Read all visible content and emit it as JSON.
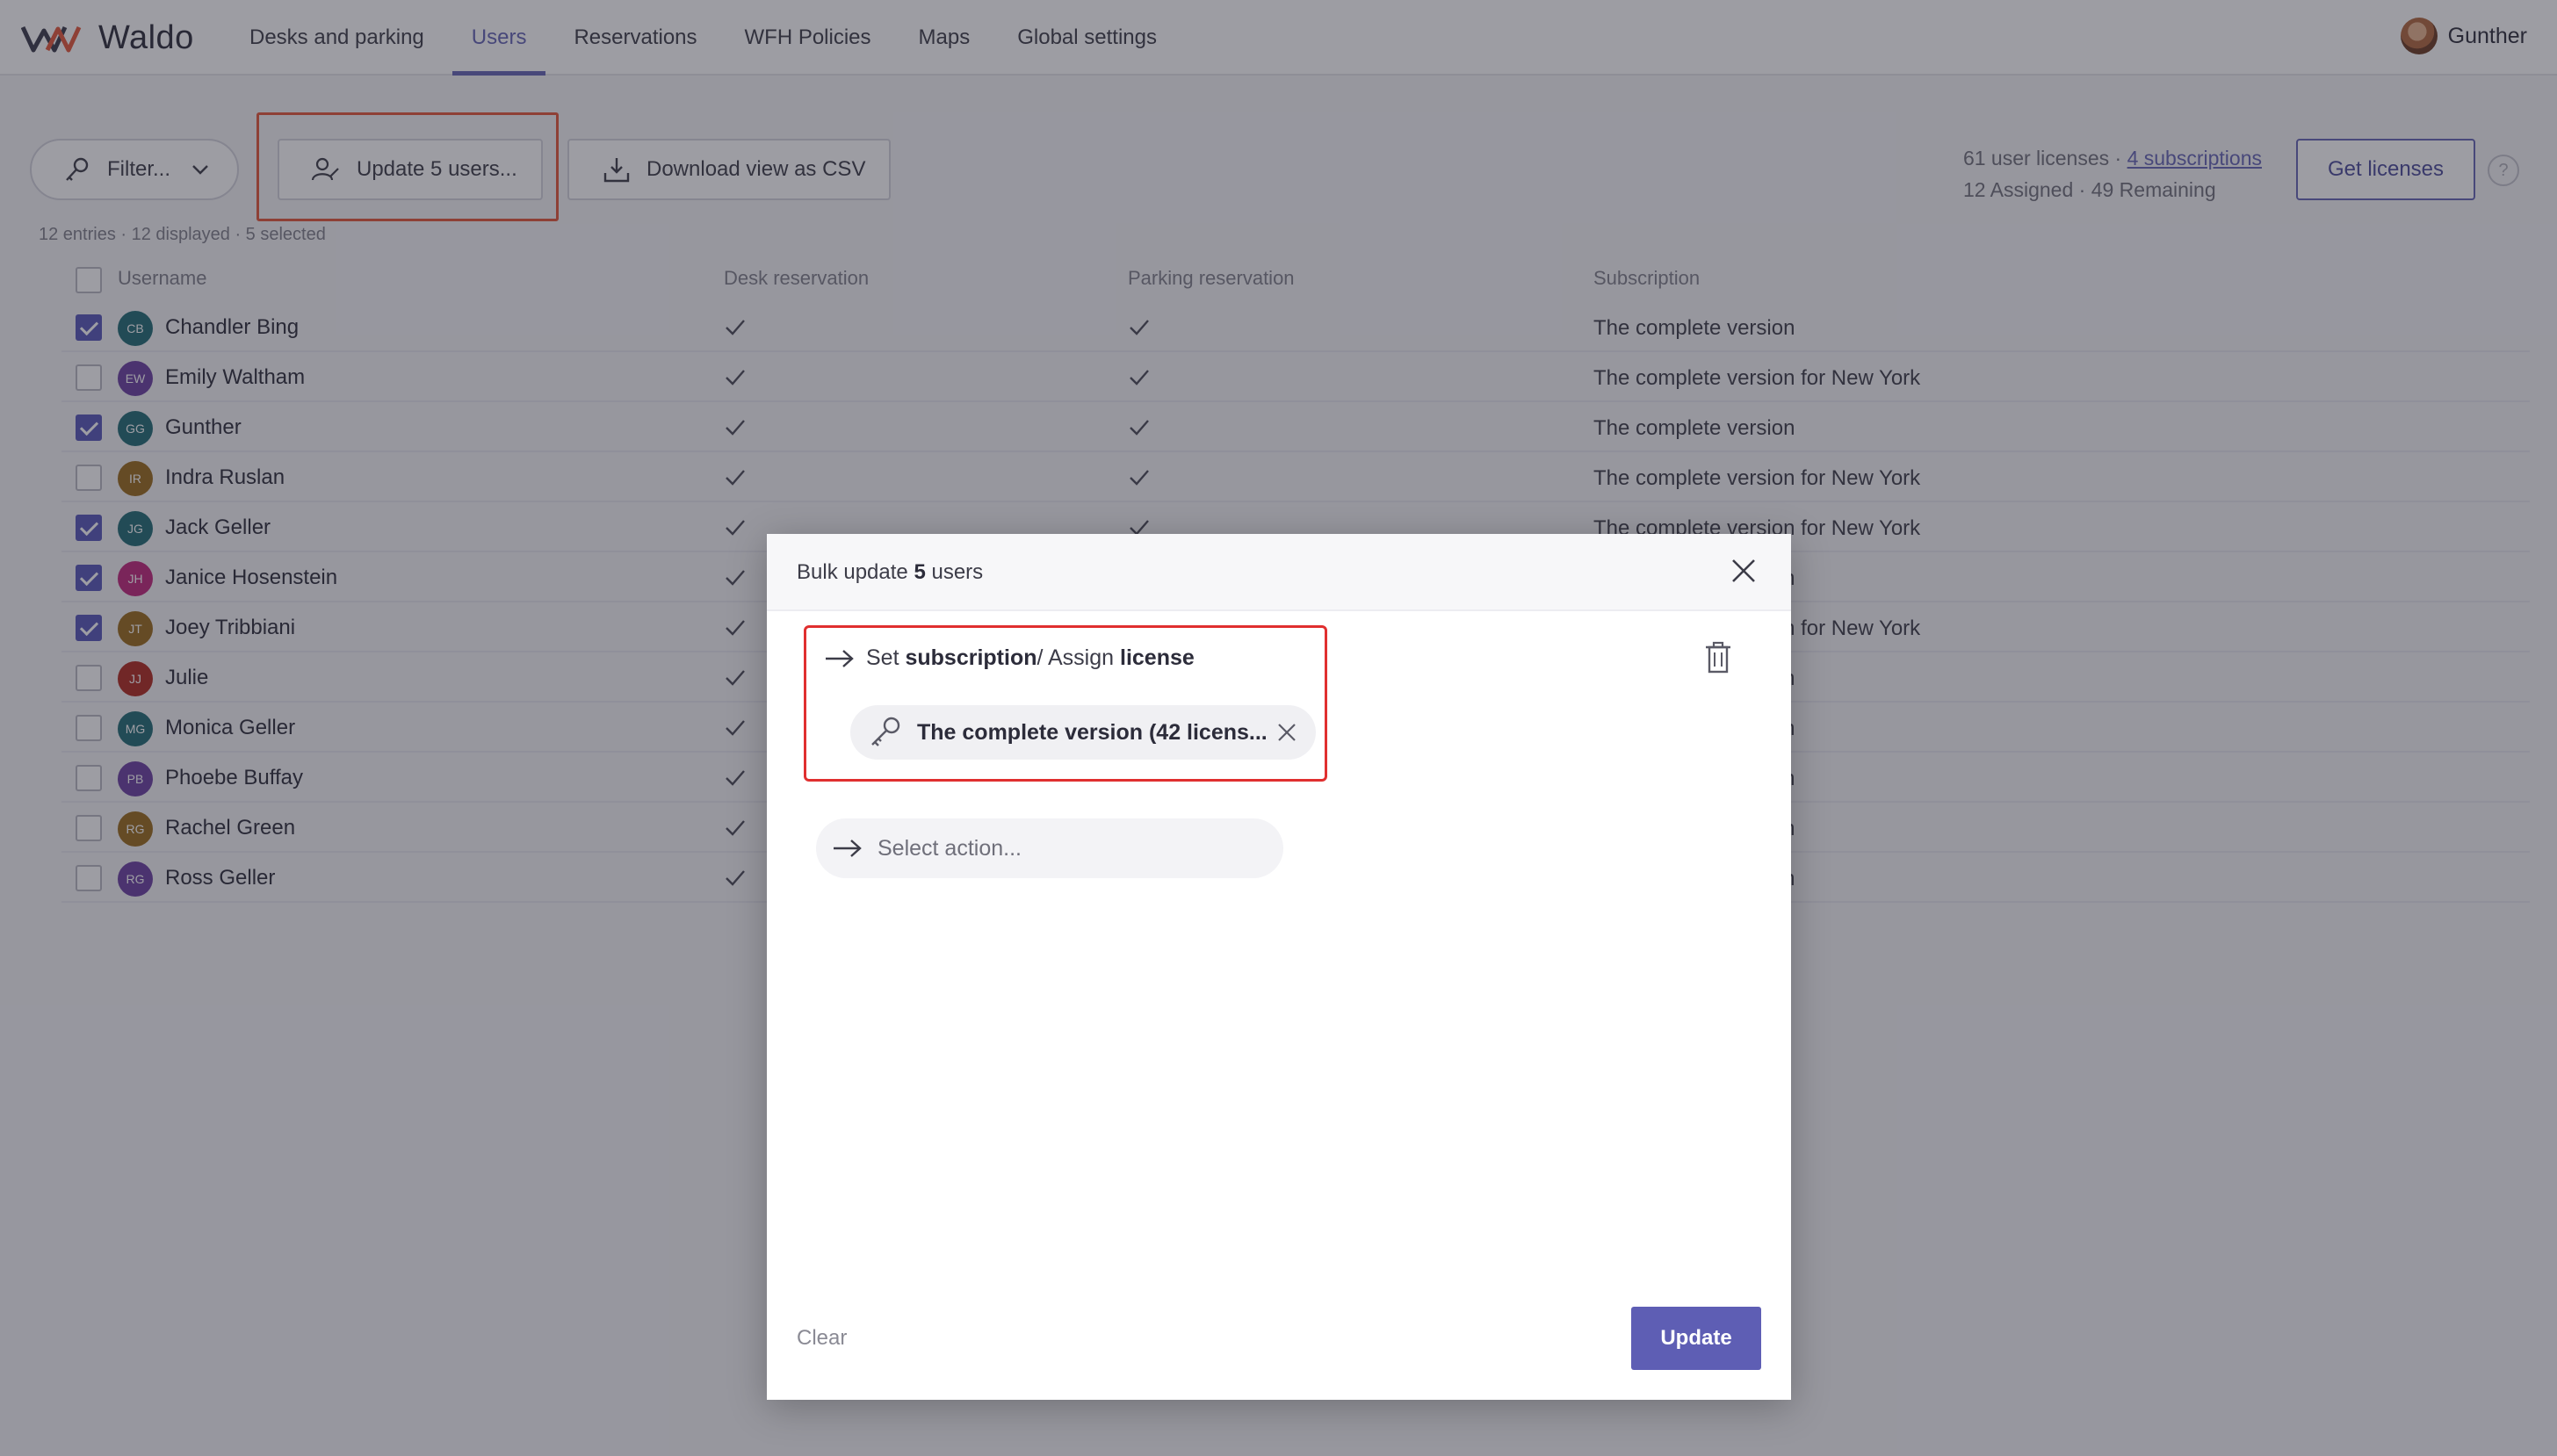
{
  "app": {
    "name": "Waldo"
  },
  "nav": {
    "items": [
      {
        "label": "Desks and parking",
        "active": false
      },
      {
        "label": "Users",
        "active": true
      },
      {
        "label": "Reservations",
        "active": false
      },
      {
        "label": "WFH Policies",
        "active": false
      },
      {
        "label": "Maps",
        "active": false
      },
      {
        "label": "Global settings",
        "active": false
      }
    ],
    "user_name": "Gunther"
  },
  "toolbar": {
    "filter_label": "Filter...",
    "update_label": "Update 5 users...",
    "csv_label": "Download view as CSV",
    "licenses_line1_prefix": "61 user licenses · ",
    "licenses_link": "4 subscriptions",
    "licenses_line2": "12 Assigned · 49 Remaining",
    "get_licenses_label": "Get licenses",
    "help_label": "?"
  },
  "entries_text": "12 entries · 12 displayed · 5 selected",
  "table": {
    "columns": {
      "username": "Username",
      "desk": "Desk reservation",
      "parking": "Parking reservation",
      "subscription": "Subscription"
    },
    "rows": [
      {
        "initials": "CB",
        "name": "Chandler Bing",
        "selected": true,
        "color": "#1f6b73",
        "subscription": "The complete version"
      },
      {
        "initials": "EW",
        "name": "Emily Waltham",
        "selected": false,
        "color": "#6a3fa0",
        "subscription": "The complete version for New York"
      },
      {
        "initials": "GG",
        "name": "Gunther",
        "selected": true,
        "color": "#1f6b73",
        "subscription": "The complete version"
      },
      {
        "initials": "IR",
        "name": "Indra Ruslan",
        "selected": false,
        "color": "#9a6a1a",
        "subscription": "The complete version for New York"
      },
      {
        "initials": "JG",
        "name": "Jack Geller",
        "selected": true,
        "color": "#1f6b73",
        "subscription": "The complete version for New York"
      },
      {
        "initials": "JH",
        "name": "Janice Hosenstein",
        "selected": true,
        "color": "#c0267a",
        "subscription": "The complete version"
      },
      {
        "initials": "JT",
        "name": "Joey Tribbiani",
        "selected": true,
        "color": "#9a6a1a",
        "subscription": "The complete version for New York"
      },
      {
        "initials": "JJ",
        "name": "Julie",
        "selected": false,
        "color": "#b0281e",
        "subscription": "The complete version"
      },
      {
        "initials": "MG",
        "name": "Monica Geller",
        "selected": false,
        "color": "#1f6b73",
        "subscription": "The complete version"
      },
      {
        "initials": "PB",
        "name": "Phoebe Buffay",
        "selected": false,
        "color": "#6a3fa0",
        "subscription": "The complete version"
      },
      {
        "initials": "RG",
        "name": "Rachel Green",
        "selected": false,
        "color": "#9a6a1a",
        "subscription": "The complete version"
      },
      {
        "initials": "RG",
        "name": "Ross Geller",
        "selected": false,
        "color": "#6a3fa0",
        "subscription": "The complete version"
      }
    ]
  },
  "modal": {
    "title_prefix": "Bulk update ",
    "title_count": "5",
    "title_suffix": " users",
    "action": {
      "label_part1": "Set ",
      "label_bold1": "subscription",
      "label_part2": " / Assign ",
      "label_bold2": "license",
      "chip_text": "The complete version (42 licens..."
    },
    "select_action_placeholder": "Select action...",
    "clear_label": "Clear",
    "update_label": "Update"
  },
  "colors": {
    "accent": "#5e5eb4",
    "highlight": "#e02f2f"
  }
}
